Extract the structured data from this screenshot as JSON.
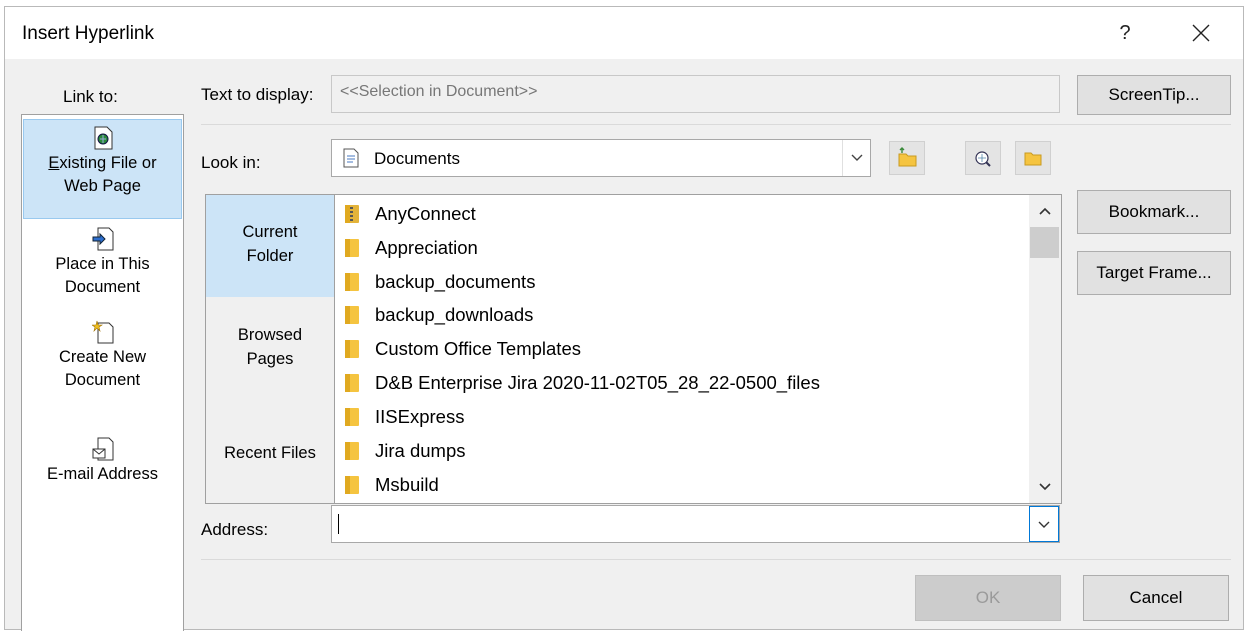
{
  "dialog": {
    "title": "Insert Hyperlink",
    "help_glyph": "?"
  },
  "link_to": {
    "label": "Link to:",
    "items": [
      {
        "l1": "Existing File or",
        "l2": "Web Page"
      },
      {
        "l1": "Place in This",
        "l2": "Document"
      },
      {
        "l1": "Create New",
        "l2": "Document"
      },
      {
        "l1": "E-mail Address",
        "l2": ""
      }
    ],
    "selected_index": 0
  },
  "text_to_display": {
    "label": "Text to display:",
    "value": "<<Selection in Document>>"
  },
  "look_in": {
    "label": "Look in:",
    "value": "Documents"
  },
  "places": [
    {
      "l1": "Current",
      "l2": "Folder"
    },
    {
      "l1": "Browsed",
      "l2": "Pages"
    },
    {
      "l1": "Recent Files",
      "l2": ""
    }
  ],
  "files": [
    {
      "name": "AnyConnect",
      "icon": "zip-folder-icon"
    },
    {
      "name": "Appreciation",
      "icon": "folder-icon"
    },
    {
      "name": "backup_documents",
      "icon": "folder-icon"
    },
    {
      "name": "backup_downloads",
      "icon": "folder-icon"
    },
    {
      "name": "Custom Office Templates",
      "icon": "folder-icon"
    },
    {
      "name": "D&B Enterprise Jira 2020-11-02T05_28_22-0500_files",
      "icon": "folder-icon"
    },
    {
      "name": "IISExpress",
      "icon": "folder-icon"
    },
    {
      "name": "Jira dumps",
      "icon": "folder-icon"
    },
    {
      "name": "Msbuild",
      "icon": "folder-icon"
    }
  ],
  "address": {
    "label": "Address:",
    "value": ""
  },
  "buttons": {
    "screentip": "ScreenTip...",
    "bookmark": "Bookmark...",
    "target_frame": "Target Frame...",
    "ok": "OK",
    "cancel": "Cancel"
  },
  "colors": {
    "selection": "#cce4f7",
    "dialog_bg": "#f0f0f0",
    "folder": "#f5c440"
  }
}
